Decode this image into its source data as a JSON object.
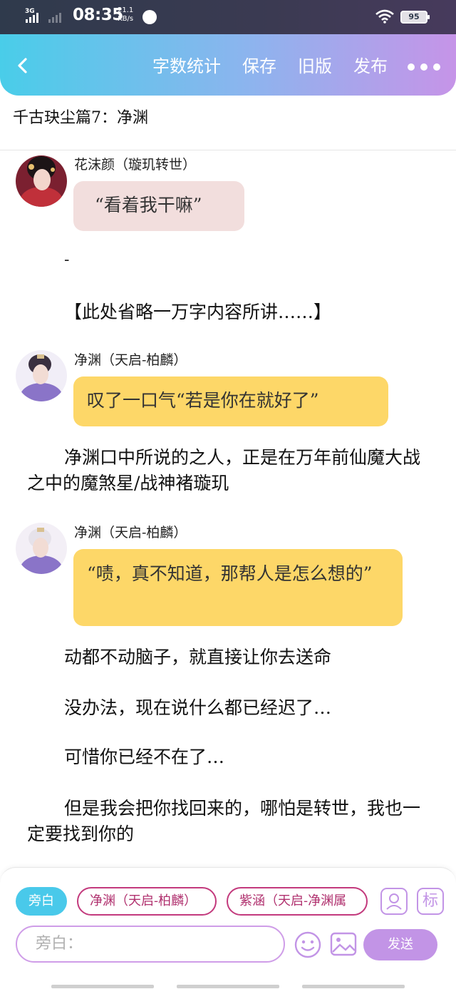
{
  "status_bar": {
    "network": "3G",
    "time": "08:35",
    "speed_value": "21.1",
    "speed_unit": "KB/s",
    "battery": "95",
    "icons": [
      "signal-icon",
      "signal-icon",
      "app-icon",
      "wifi-icon",
      "battery-icon"
    ]
  },
  "header": {
    "back_icon": "chevron-left-icon",
    "actions": [
      "字数统计",
      "保存",
      "旧版",
      "发布"
    ],
    "more_icon": "more-dots-icon"
  },
  "title": "千古玦尘篇7：净渊",
  "messages": [
    {
      "speaker": "花沫颜（璇玑转世）",
      "text": "“看着我干嘛”",
      "color": "#f2dedd"
    },
    {
      "speaker": "净渊（天启-柏麟）",
      "text": "叹了一口气“若是你在就好了”",
      "color": "#fdd768"
    },
    {
      "speaker": "净渊（天启-柏麟）",
      "text": "“啧，真不知道，那帮人是怎么想的”",
      "color": "#fdd768"
    }
  ],
  "narration": {
    "dash": "-",
    "omitted": "【此处省略一万字内容所讲……】",
    "p1": "净渊口中所说的之人，正是在万年前仙魔大战之中的魔煞星/战神褚璇玑",
    "p2": "动都不动脑子，就直接让你去送命",
    "p3": "没办法，现在说什么都已经迟了…",
    "p4": "可惜你已经不在了…",
    "p5": "但是我会把你找回来的，哪怕是转世，我也一定要找到你的"
  },
  "composer": {
    "roles": [
      "旁白",
      "净渊（天启-柏麟）",
      "紫涵（天启-净渊属"
    ],
    "label_button": "标",
    "input_placeholder": "旁白：",
    "send_label": "发送",
    "accent": "#c294e6"
  }
}
